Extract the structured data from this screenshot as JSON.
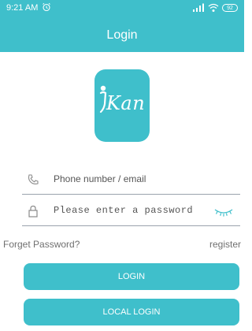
{
  "status": {
    "time": "9:21 AM",
    "battery": "92"
  },
  "header": {
    "title": "Login"
  },
  "logo": {
    "text": "Kan"
  },
  "form": {
    "phone_placeholder": "Phone number / email",
    "password_placeholder": "Please enter a password"
  },
  "links": {
    "forget": "Forget Password?",
    "register": "register"
  },
  "buttons": {
    "login": "LOGIN",
    "local_login": "LOCAL LOGIN"
  },
  "colors": {
    "accent": "#3fbfcb"
  },
  "icons": {
    "status": [
      "alarm-icon",
      "signal-icon",
      "wifi-icon",
      "battery-icon"
    ],
    "fields": [
      "phone-icon",
      "lock-icon",
      "eye-closed-icon"
    ]
  }
}
